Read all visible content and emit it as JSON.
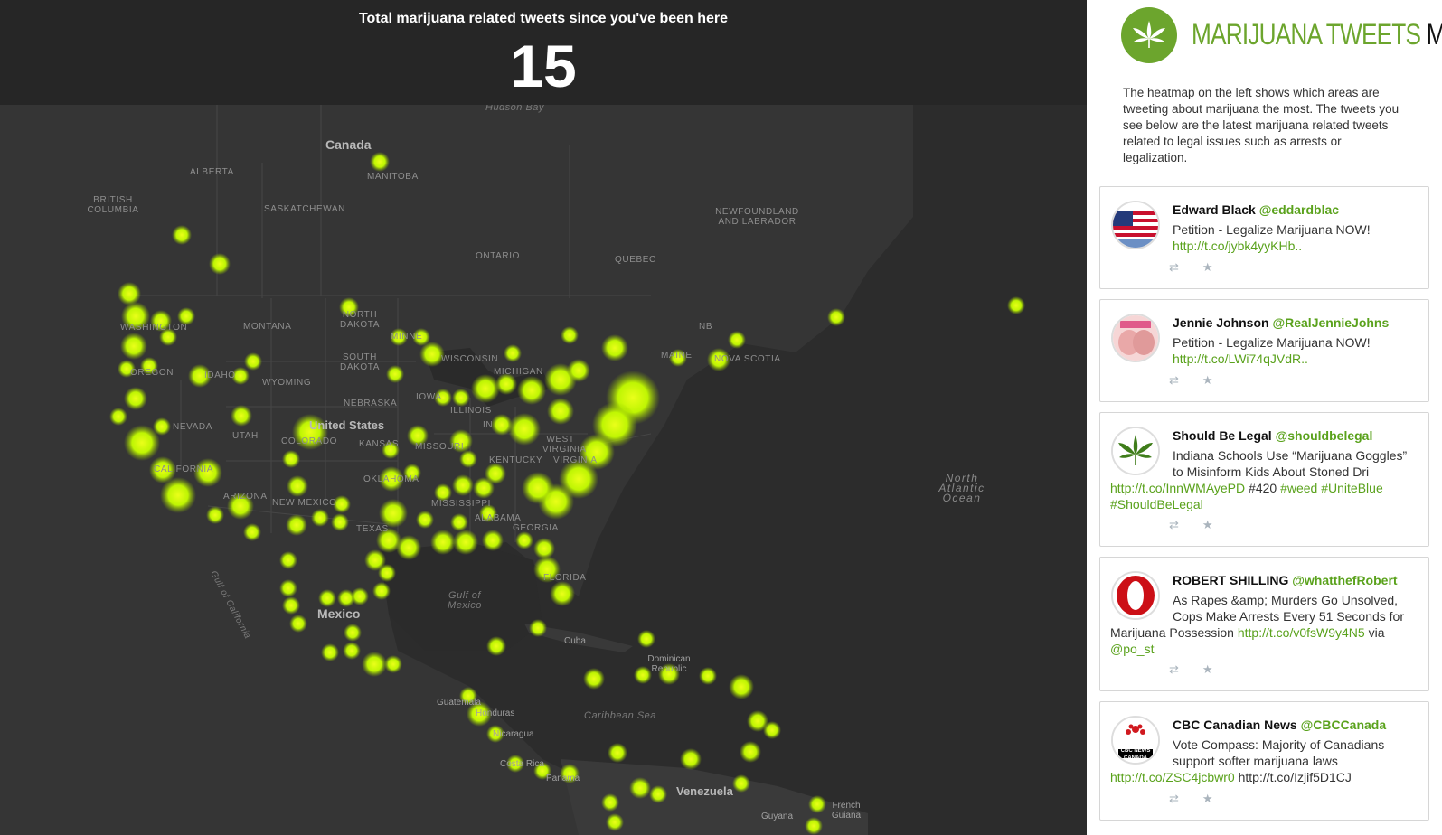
{
  "counter": {
    "caption": "Total marijuana related tweets since you've been here",
    "count": "15"
  },
  "map": {
    "labels": {
      "hudson_bay": "Hudson Bay",
      "canada": "Canada",
      "alberta": "ALBERTA",
      "manitoba": "MANITOBA",
      "british_columbia": "BRITISH COLUMBIA",
      "saskatchewan": "SASKATCHEWAN",
      "newfoundland": "NEWFOUNDLAND AND LABRADOR",
      "ontario": "ONTARIO",
      "quebec": "QUEBEC",
      "montana": "MONTANA",
      "north_dakota": "NORTH DAKOTA",
      "south_dakota": "SOUTH DAKOTA",
      "wyoming": "WYOMING",
      "minnesota": "MINNE",
      "wisconsin": "WISCONSIN",
      "michigan": "MICHIGAN",
      "nb": "NB",
      "maine": "MAINE",
      "nova_scotia": "NOVA SCOTIA",
      "oregon": "OREGON",
      "idaho": "IDAHO",
      "washington": "WASHINGTON",
      "nebraska": "NEBRASKA",
      "iowa": "IOWA",
      "illinois": "ILLINOIS",
      "indiana": "IN",
      "nevada": "NEVADA",
      "utah": "UTAH",
      "colorado": "COLORADO",
      "united_states": "United States",
      "kansas": "KANSAS",
      "missouri": "MISSOURI",
      "kentucky": "KENTUCKY",
      "west_virginia": "WEST VIRGINIA",
      "virginia": "VIRGINIA",
      "california": "CALIFORNIA",
      "arizona": "ARIZONA",
      "new_mexico": "NEW MEXICO",
      "oklahoma": "OKLAHOMA",
      "mississippi": "MISSISSIPPI",
      "alabama": "ALABAMA",
      "georgia": "GEORGIA",
      "texas": "TEXAS",
      "florida": "FLORIDA",
      "gulf_california": "Gulf of California",
      "gulf_mexico": "Gulf of Mexico",
      "mexico": "Mexico",
      "cuba": "Cuba",
      "dominican": "Dominican Republic",
      "caribbean": "Caribbean Sea",
      "guatemala": "Guatemala",
      "honduras": "Honduras",
      "nicaragua": "Nicaragua",
      "costa_rica": "Costa Rica",
      "panama": "Panama",
      "venezuela": "Venezuela",
      "guyana": "Guyana",
      "french_guiana": "French Guiana",
      "atlantic": "North Atlantic Ocean"
    }
  },
  "sidebar": {
    "title_green": "MARIJUANA TWEETS",
    "title_dark": "MAP",
    "logo_icon": "cannabis-leaf-icon",
    "brand_color": "#6ca52d",
    "intro": "The heatmap on the left shows which areas are tweeting about marijuana the most. The tweets you see below are the latest marijuana related tweets related to legal issues such as arrests or legalization.",
    "tweets": [
      {
        "name": "Edward Black",
        "handle": "@eddardblac",
        "text": "Petition - Legalize Marijuana NOW!",
        "link": "http://t.co/jybk4yyKHb..",
        "avatar_icon": "us-flag-avatar"
      },
      {
        "name": "Jennie Johnson",
        "handle": "@RealJennieJohns",
        "text": "Petition - Legalize Marijuana NOW!",
        "link": "http://t.co/LWi74qJVdR..",
        "avatar_icon": "photo-avatar"
      },
      {
        "name": "Should Be Legal",
        "handle": "@shouldbelegal",
        "text1": "Indiana Schools Use “Marijuana Goggles”",
        "text2": "to Misinform Kids About Stoned Dri",
        "link": "http://t.co/InnWMAyePD",
        "tag_plain": "#420",
        "tag1": "#weed",
        "tag2": "#UniteBlue",
        "tag3": "#ShouldBeLegal",
        "avatar_icon": "cannabis-leaf-avatar"
      },
      {
        "name": "ROBERT SHILLING",
        "handle": "@whatthefRobert",
        "text1": "As Rapes &amp; Murders Go Unsolved,",
        "text2": "Cops Make Arrests Every 51 Seconds for",
        "text3": "Marijuana Possession",
        "link": "http://t.co/v0fsW9y4N5",
        "via": "via",
        "mention": "@po_st",
        "avatar_icon": "opera-logo-avatar"
      },
      {
        "name": "CBC Canadian News",
        "handle": "@CBCCanada",
        "text1": "Vote Compass: Majority of Canadians",
        "text2": "support softer marijuana laws",
        "link": "http://t.co/ZSC4jcbwr0",
        "plain_link": "http://t.co/Izjif5D1CJ",
        "avatar_icon": "cbc-news-avatar",
        "avatar_text": "CBC NEWS CANADA"
      }
    ]
  }
}
